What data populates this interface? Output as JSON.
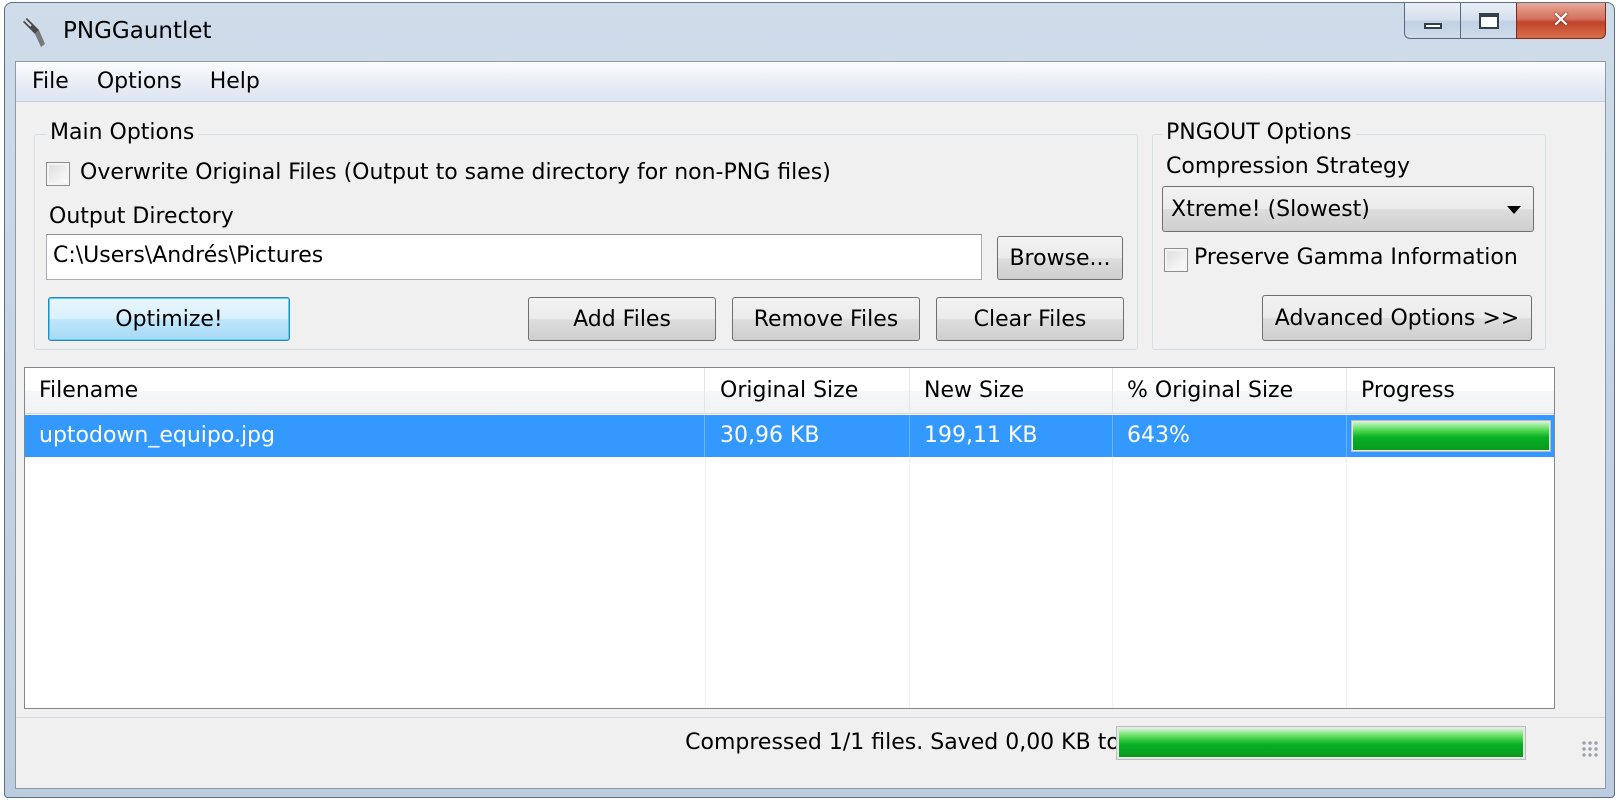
{
  "window": {
    "title": "PNGGauntlet",
    "icon": "pen-nib-icon"
  },
  "menu": [
    "File",
    "Options",
    "Help"
  ],
  "main_options": {
    "legend": "Main Options",
    "overwrite_label": "Overwrite Original Files (Output to same directory for non-PNG files)",
    "overwrite_checked": false,
    "output_dir_label": "Output Directory",
    "output_dir_value": "C:\\Users\\Andrés\\Pictures",
    "browse_label": "Browse...",
    "optimize_label": "Optimize!",
    "add_files_label": "Add Files",
    "remove_files_label": "Remove Files",
    "clear_files_label": "Clear Files"
  },
  "pngout_options": {
    "legend": "PNGOUT Options",
    "strategy_label": "Compression Strategy",
    "strategy_value": "Xtreme! (Slowest)",
    "preserve_gamma_label": "Preserve Gamma Information",
    "preserve_gamma_checked": false,
    "advanced_label": "Advanced Options >>"
  },
  "file_list": {
    "columns": [
      "Filename",
      "Original Size",
      "New Size",
      "% Original Size",
      "Progress"
    ],
    "rows": [
      {
        "filename": "uptodown_equipo.jpg",
        "original_size": "30,96 KB",
        "new_size": "199,11 KB",
        "percent": "643%",
        "progress": 1.0
      }
    ]
  },
  "status": {
    "text": "Compressed 1/1 files. Saved 0,00 KB total.",
    "progress": 1.0
  },
  "colors": {
    "selection": "#3399ff",
    "progress_green": "#06b025"
  }
}
